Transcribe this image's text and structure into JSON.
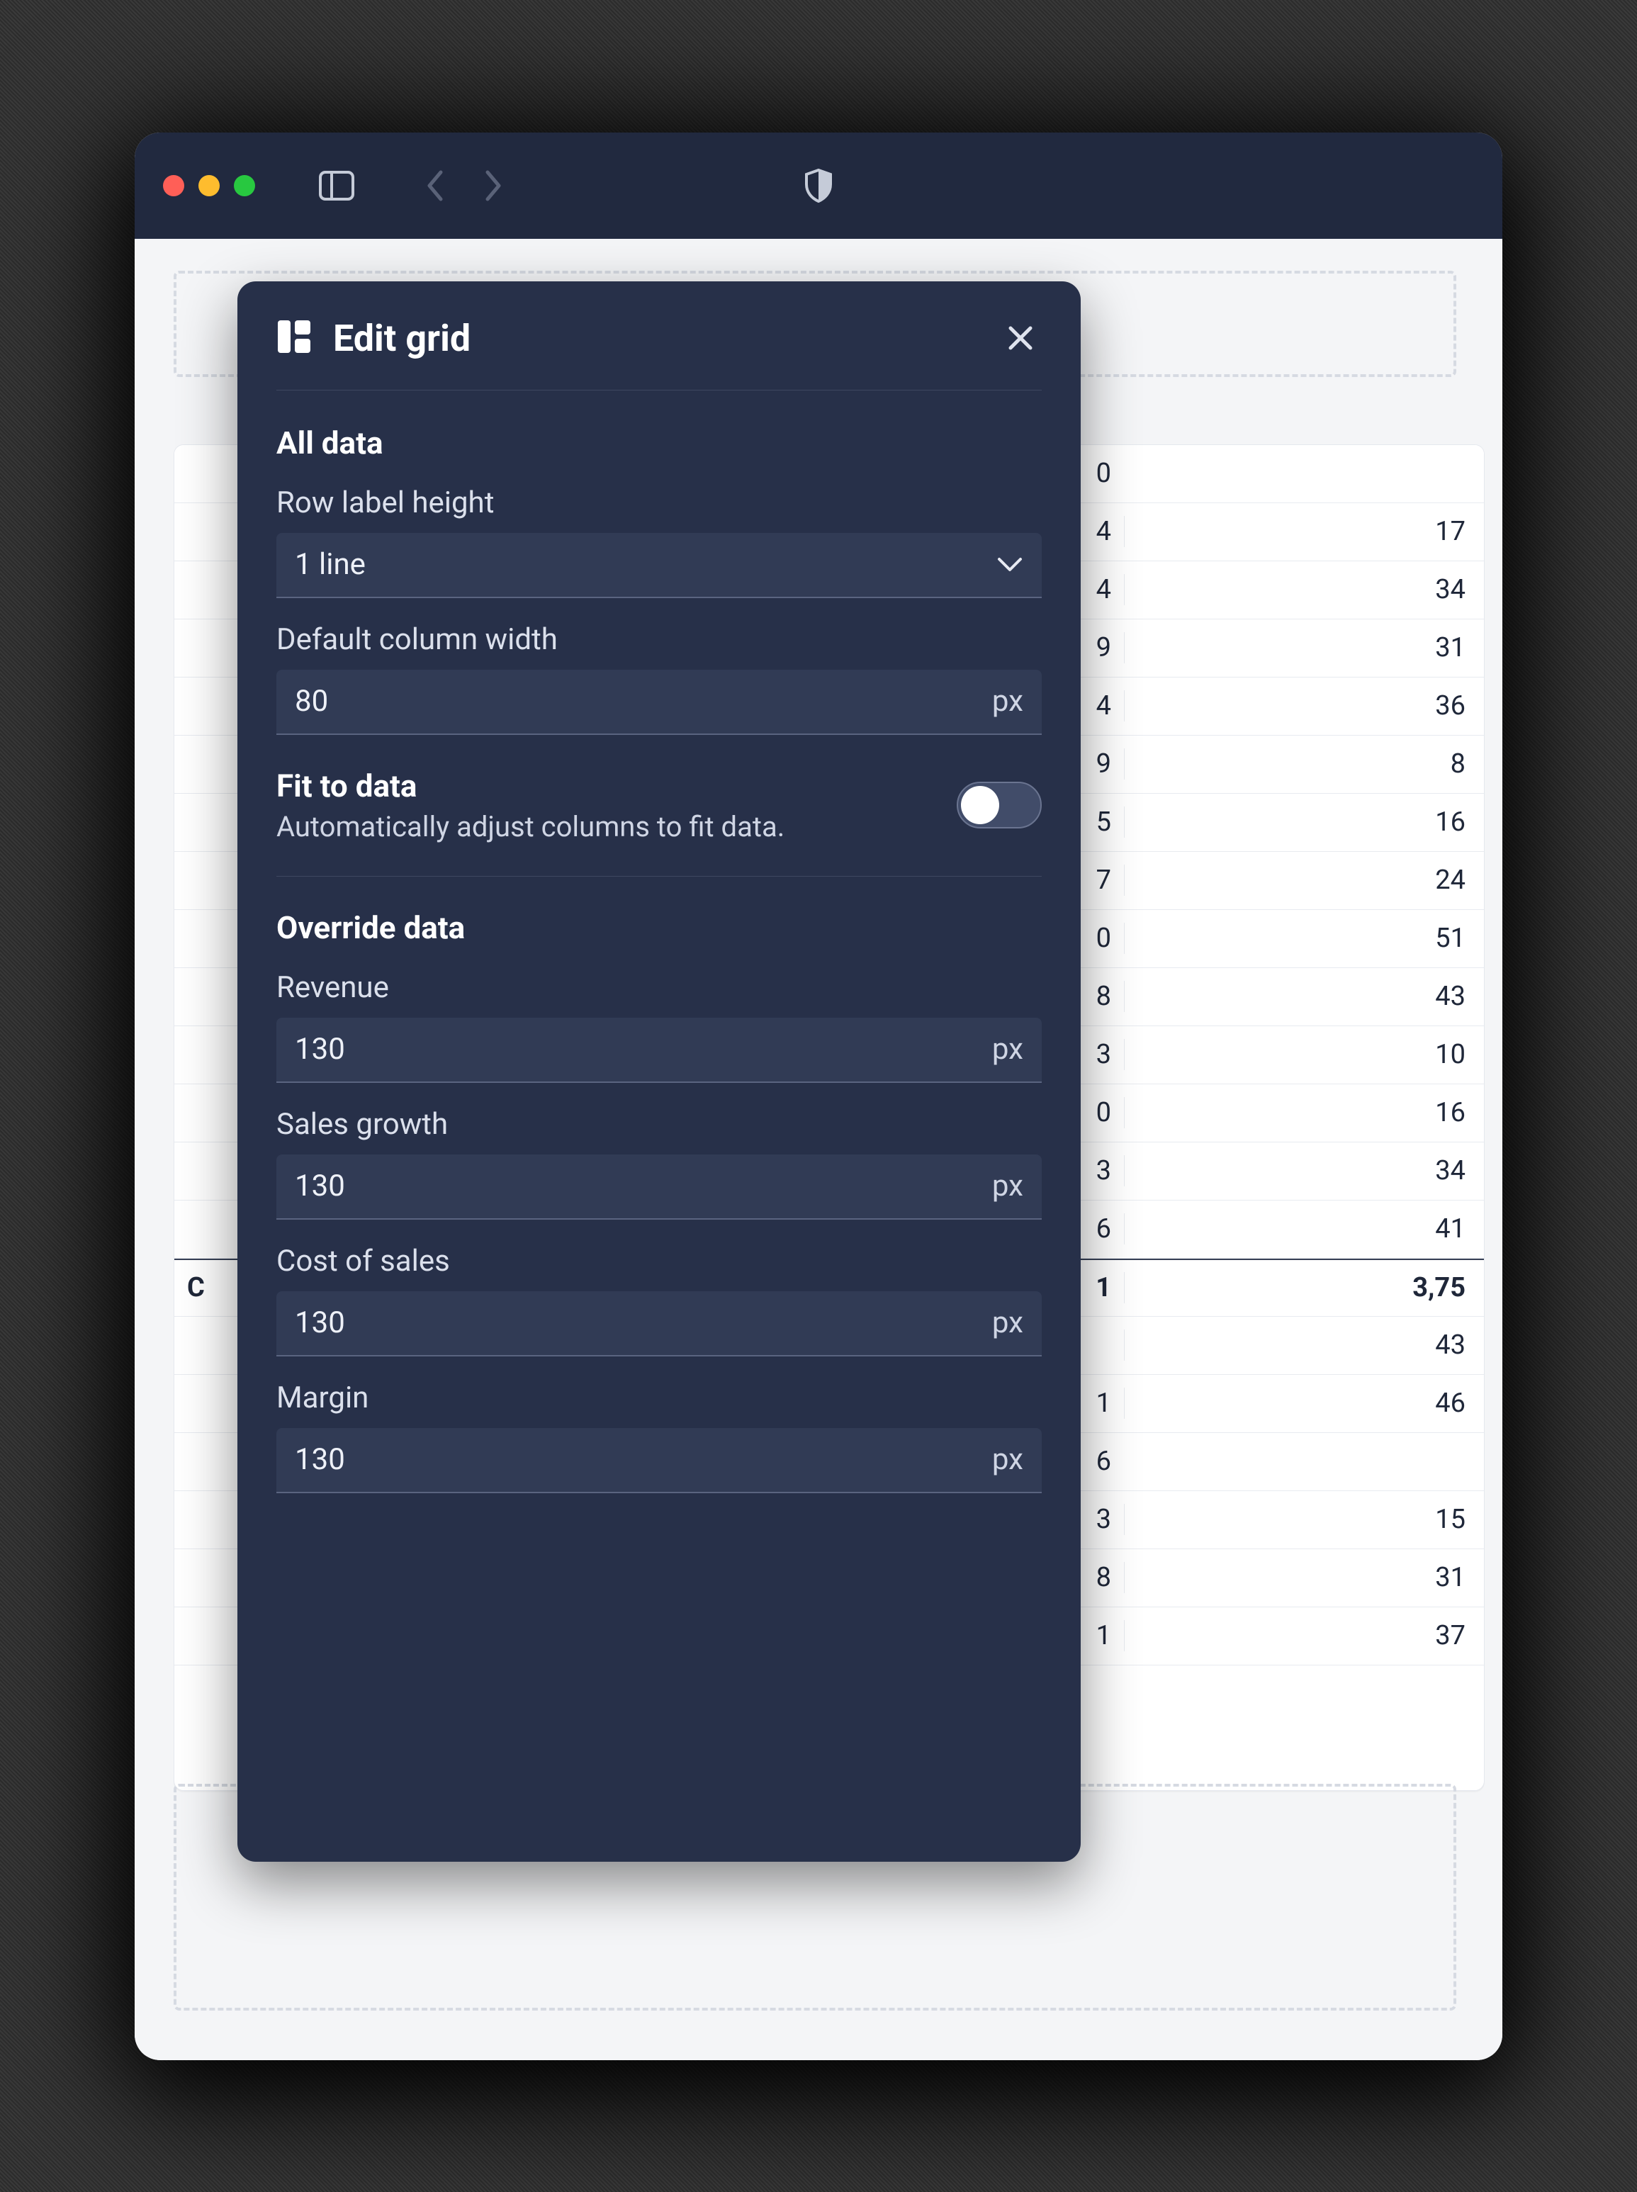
{
  "panel": {
    "title": "Edit grid",
    "sections": {
      "all_data": {
        "heading": "All data",
        "row_label_height": {
          "label": "Row label height",
          "value": "1 line"
        },
        "default_col_width": {
          "label": "Default column width",
          "value": "80",
          "unit": "px"
        },
        "fit_to_data": {
          "title": "Fit to data",
          "desc": "Automatically adjust columns to fit data.",
          "enabled": false
        }
      },
      "override": {
        "heading": "Override data",
        "items": [
          {
            "label": "Revenue",
            "value": "130",
            "unit": "px"
          },
          {
            "label": "Sales growth",
            "value": "130",
            "unit": "px"
          },
          {
            "label": "Cost of sales",
            "value": "130",
            "unit": "px"
          },
          {
            "label": "Margin",
            "value": "130",
            "unit": "px"
          }
        ]
      }
    }
  },
  "table": {
    "rows": [
      {
        "label": "",
        "c1": "0",
        "c2": "",
        "bold": false,
        "header": true
      },
      {
        "label": "",
        "c1": "4",
        "c2": "17",
        "bold": false
      },
      {
        "label": "",
        "c1": "4",
        "c2": "34",
        "bold": false
      },
      {
        "label": "",
        "c1": "9",
        "c2": "31",
        "bold": false
      },
      {
        "label": "",
        "c1": "4",
        "c2": "36",
        "bold": false
      },
      {
        "label": "",
        "c1": "9",
        "c2": "8",
        "bold": false
      },
      {
        "label": "",
        "c1": "5",
        "c2": "16",
        "bold": false
      },
      {
        "label": "",
        "c1": "7",
        "c2": "24",
        "bold": false
      },
      {
        "label": "",
        "c1": "0",
        "c2": "51",
        "bold": false
      },
      {
        "label": "",
        "c1": "8",
        "c2": "43",
        "bold": false
      },
      {
        "label": "",
        "c1": "3",
        "c2": "10",
        "bold": false
      },
      {
        "label": "",
        "c1": "0",
        "c2": "16",
        "bold": false
      },
      {
        "label": "",
        "c1": "3",
        "c2": "34",
        "bold": false
      },
      {
        "label": "",
        "c1": "6",
        "c2": "41",
        "bold": false
      },
      {
        "label": "C",
        "c1": "1",
        "c2": "3,75",
        "bold": true,
        "subtotal": true
      },
      {
        "label": "",
        "c1": "",
        "c2": "43",
        "bold": false
      },
      {
        "label": "",
        "c1": "1",
        "c2": "46",
        "bold": false
      },
      {
        "label": "",
        "c1": "6",
        "c2": "",
        "bold": false
      },
      {
        "label": "",
        "c1": "3",
        "c2": "15",
        "bold": false
      },
      {
        "label": "",
        "c1": "8",
        "c2": "31",
        "bold": false
      },
      {
        "label": "",
        "c1": "1",
        "c2": "37",
        "bold": false
      }
    ]
  }
}
